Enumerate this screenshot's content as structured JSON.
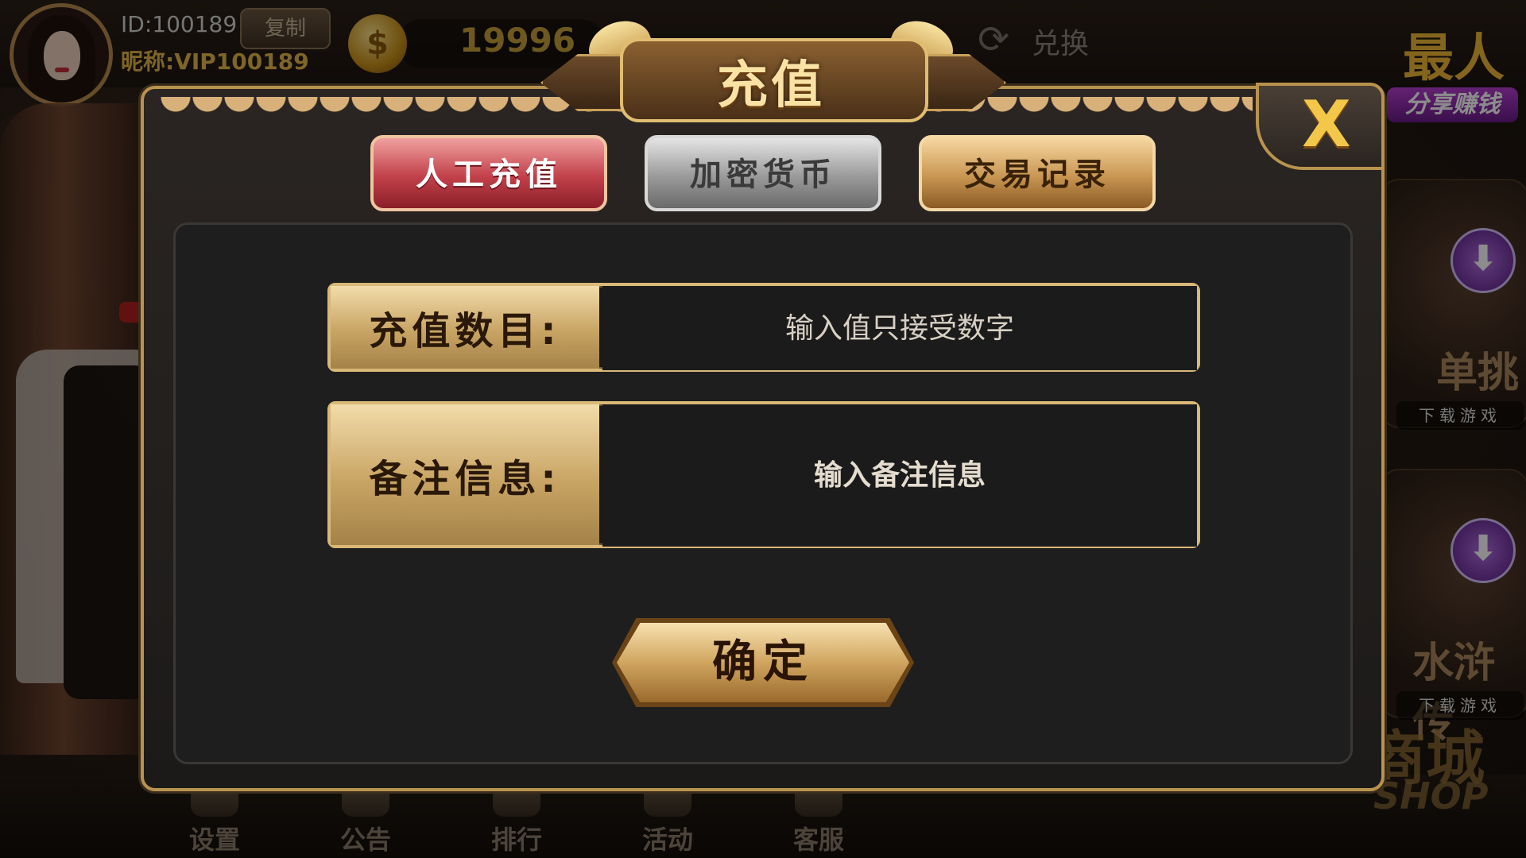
{
  "player": {
    "id_text": "ID:100189",
    "nickname_text": "昵称:VIP100189",
    "copy_label": "复制"
  },
  "wallet": {
    "balance": "19996",
    "exchange_label": "兑换",
    "coin_icon": "dollar-coin-icon"
  },
  "promo": {
    "big_text": "最人",
    "tag": "分享赚钱"
  },
  "side_cards": [
    {
      "title": "单挑",
      "download_label": "下载游戏",
      "icon": "download-arrow-icon"
    },
    {
      "title": "水浒传",
      "download_label": "下载游戏",
      "icon": "download-arrow-icon"
    }
  ],
  "shop": {
    "title": "商城",
    "subtitle": "SHOP"
  },
  "bottom_nav": [
    {
      "label": "设置",
      "icon": "gear-icon"
    },
    {
      "label": "公告",
      "icon": "megaphone-icon"
    },
    {
      "label": "排行",
      "icon": "bar-chart-icon"
    },
    {
      "label": "活动",
      "icon": "gift-icon"
    },
    {
      "label": "客服",
      "icon": "headset-icon"
    }
  ],
  "modal": {
    "title": "充值",
    "close_label": "X",
    "tabs": [
      {
        "label": "人工充值",
        "state": "active",
        "color": "#c2414a"
      },
      {
        "label": "加密货币",
        "state": "inactive",
        "color": "#9a9a9a"
      },
      {
        "label": "交易记录",
        "state": "inactive",
        "color": "#c99652"
      }
    ],
    "form": {
      "amount": {
        "label": "充值数目:",
        "placeholder": "输入值只接受数字",
        "value": ""
      },
      "note": {
        "label": "备注信息:",
        "placeholder": "输入备注信息",
        "value": ""
      }
    },
    "confirm_label": "确定"
  },
  "colors": {
    "gold_accent": "#d9b878",
    "balance_gold": "#c6a13a",
    "close_yellow": "#f3c84a",
    "panel_bg": "#1f1e1e"
  }
}
